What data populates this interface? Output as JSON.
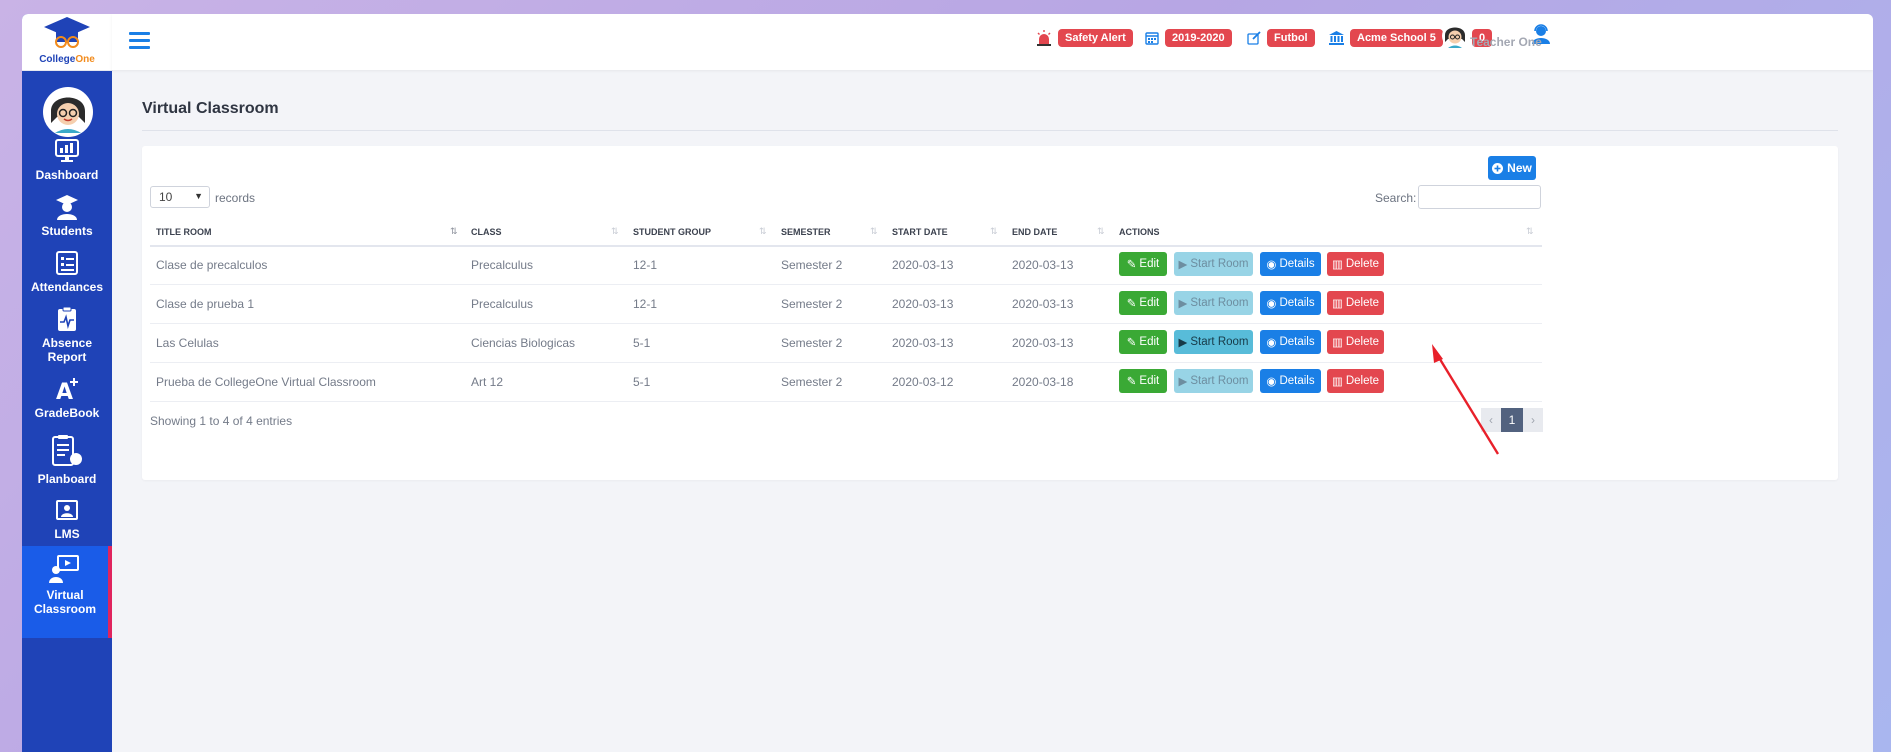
{
  "brand": {
    "name_part1": "College",
    "name_part2": "One"
  },
  "sidebar": {
    "items": [
      {
        "label": "Dashboard",
        "icon": "dashboard-monitor-icon"
      },
      {
        "label": "Students",
        "icon": "graduate-student-icon"
      },
      {
        "label": "Attendances",
        "icon": "attendance-list-icon"
      },
      {
        "label": "Absence Report",
        "icon": "absence-report-icon"
      },
      {
        "label": "GradeBook",
        "icon": "grade-a-plus-icon"
      },
      {
        "label": "Planboard",
        "icon": "planboard-clipboard-icon"
      },
      {
        "label": "LMS",
        "icon": "lms-screen-icon"
      },
      {
        "label": "Virtual Classroom",
        "icon": "virtual-classroom-icon",
        "active": true
      }
    ]
  },
  "topbar": {
    "safety_alert": "Safety Alert",
    "year": "2019-2020",
    "sport": "Futbol",
    "school": "Acme School 5",
    "messages_count": "0",
    "user_name": "Teacher One"
  },
  "page": {
    "title": "Virtual Classroom"
  },
  "table_controls": {
    "new_label": "New",
    "records_value": "10",
    "records_label": "records",
    "search_label": "Search:",
    "search_value": ""
  },
  "table": {
    "columns": [
      "TITLE ROOM",
      "CLASS",
      "STUDENT GROUP",
      "SEMESTER",
      "START DATE",
      "END DATE",
      "ACTIONS"
    ],
    "rows": [
      {
        "title": "Clase de precalculos",
        "class": "Precalculus",
        "group": "12-1",
        "semester": "Semester 2",
        "start": "2020-03-13",
        "end": "2020-03-13",
        "start_enabled": false
      },
      {
        "title": "Clase de prueba 1",
        "class": "Precalculus",
        "group": "12-1",
        "semester": "Semester 2",
        "start": "2020-03-13",
        "end": "2020-03-13",
        "start_enabled": false
      },
      {
        "title": "Las Celulas",
        "class": "Ciencias Biologicas",
        "group": "5-1",
        "semester": "Semester 2",
        "start": "2020-03-13",
        "end": "2020-03-13",
        "start_enabled": true
      },
      {
        "title": "Prueba de CollegeOne Virtual Classroom",
        "class": "Art 12",
        "group": "5-1",
        "semester": "Semester 2",
        "start": "2020-03-12",
        "end": "2020-03-18",
        "start_enabled": false
      }
    ],
    "action_labels": {
      "edit": "Edit",
      "start": "Start Room",
      "details": "Details",
      "delete": "Delete"
    },
    "footer": "Showing 1 to 4 of 4 entries",
    "pagination": {
      "prev": "‹",
      "page": "1",
      "next": "›"
    }
  },
  "colors": {
    "sidebar": "#1f43b7",
    "accent": "#1a7fe6",
    "danger": "#e3474f",
    "success": "#3aa935",
    "info": "#58bcd9",
    "annotation_arrow": "#e8202a"
  }
}
